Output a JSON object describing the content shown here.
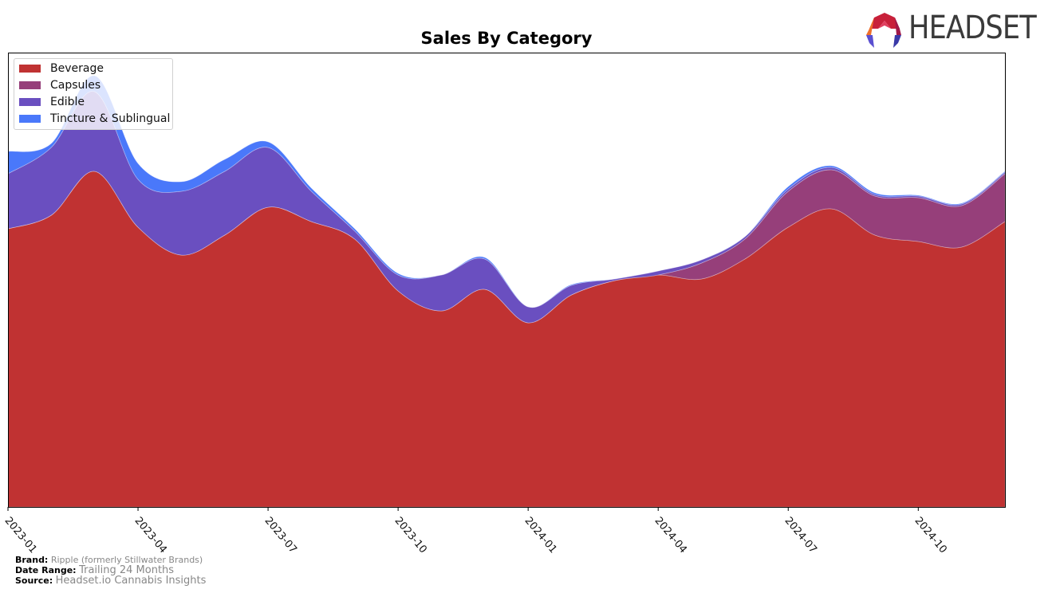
{
  "header": {
    "title": "Sales By Category",
    "logo_text": "HEADSET"
  },
  "chart_data": {
    "type": "area",
    "stacked": true,
    "smooth": true,
    "title": "Sales By Category",
    "xlabel": "",
    "ylabel": "",
    "y_axis_labels_visible": false,
    "grid": false,
    "legend_position": "top-left",
    "x": [
      "2023-01",
      "2023-02",
      "2023-03",
      "2023-04",
      "2023-05",
      "2023-06",
      "2023-07",
      "2023-08",
      "2023-09",
      "2023-10",
      "2023-11",
      "2023-12",
      "2024-01",
      "2024-02",
      "2024-03",
      "2024-04",
      "2024-05",
      "2024-06",
      "2024-07",
      "2024-08",
      "2024-09",
      "2024-10",
      "2024-11",
      "2024-12"
    ],
    "x_ticks": [
      "2023-01",
      "2023-04",
      "2023-07",
      "2023-10",
      "2024-01",
      "2024-04",
      "2024-07",
      "2024-10"
    ],
    "ylim": [
      0,
      570
    ],
    "series": [
      {
        "name": "Beverage",
        "color": "#c03232",
        "values": [
          349,
          366,
          421,
          351,
          316,
          341,
          376,
          358,
          336,
          271,
          246,
          273,
          231,
          266,
          284,
          291,
          286,
          311,
          351,
          374,
          341,
          333,
          326,
          358
        ]
      },
      {
        "name": "Capsules",
        "color": "#963f7a",
        "values": [
          0,
          0,
          0,
          0,
          0,
          0,
          0,
          0,
          0,
          0,
          0,
          0,
          0,
          0,
          0,
          0,
          20,
          25,
          45,
          49,
          49,
          55,
          52,
          60
        ]
      },
      {
        "name": "Edible",
        "color": "#6a4fc0",
        "values": [
          69,
          85,
          100,
          60,
          80,
          80,
          75,
          38,
          10,
          20,
          45,
          38,
          20,
          12,
          2,
          5,
          4,
          3,
          3,
          3,
          2,
          2,
          2,
          2
        ]
      },
      {
        "name": "Tincture & Sublingual",
        "color": "#4a78fa",
        "values": [
          28,
          5,
          20,
          20,
          12,
          15,
          7,
          4,
          3,
          2,
          0,
          2,
          0,
          1,
          0,
          0,
          0,
          0,
          3,
          2,
          2,
          1,
          1,
          1
        ]
      }
    ]
  },
  "legend": [
    {
      "label": "Beverage",
      "color": "#c03232"
    },
    {
      "label": "Capsules",
      "color": "#963f7a"
    },
    {
      "label": "Edible",
      "color": "#6a4fc0"
    },
    {
      "label": "Tincture & Sublingual",
      "color": "#4a78fa"
    }
  ],
  "footer": {
    "brand_label": "Brand:",
    "brand_value": "Ripple (formerly Stillwater Brands)",
    "date_label": "Date Range:",
    "date_value": "Trailing 24 Months",
    "source_label": "Source:",
    "source_value": "Headset.io Cannabis Insights"
  }
}
